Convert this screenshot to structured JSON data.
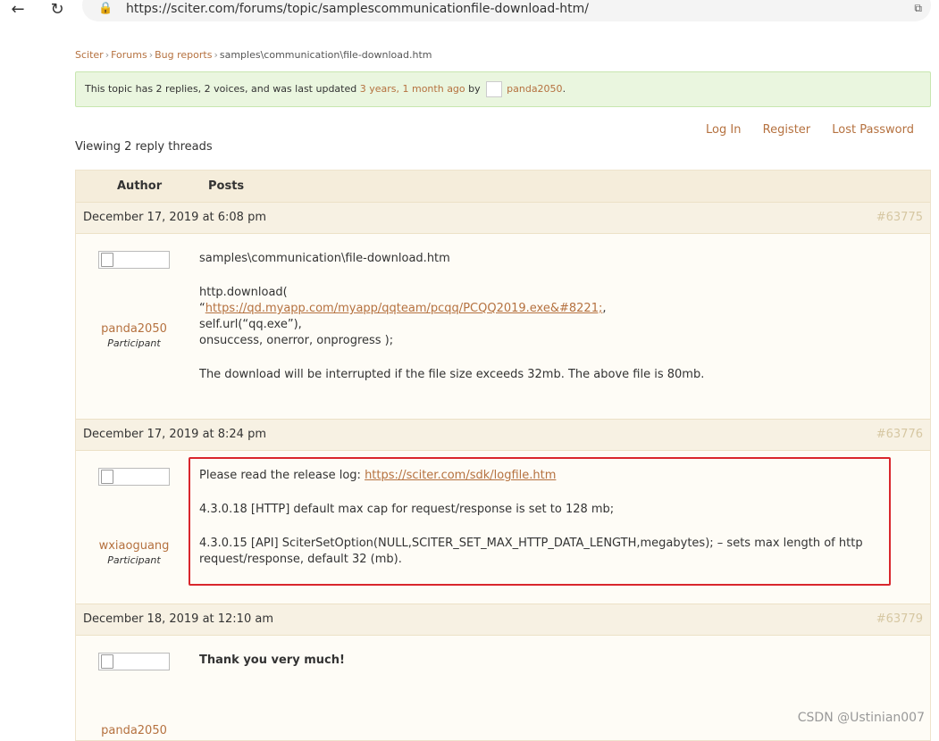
{
  "browser": {
    "url": "https://sciter.com/forums/topic/samplescommunicationfile-download-htm/",
    "back_icon": "←",
    "reload_icon": "↻",
    "lock_icon": "🔒",
    "tab_icon": "⧉"
  },
  "breadcrumb": {
    "items": [
      "Sciter",
      "Forums",
      "Bug reports"
    ],
    "current": "samples\\communication\\file-download.htm",
    "separator": "›"
  },
  "topic_info": {
    "prefix": "This topic has 2 replies, 2 voices, and was last updated ",
    "last_updated": "3 years, 1 month ago",
    "by": " by ",
    "user": "panda2050",
    "suffix": "."
  },
  "auth": {
    "login": "Log In",
    "register": "Register",
    "lost_password": "Lost Password"
  },
  "viewing": "Viewing 2 reply threads",
  "table": {
    "col_author": "Author",
    "col_posts": "Posts"
  },
  "posts": [
    {
      "date": "December 17, 2019 at 6:08 pm",
      "permalink": "#63775",
      "author": "panda2050",
      "role": "Participant",
      "lines": [
        "samples\\communication\\file-download.htm",
        "http.download(",
        "“",
        "https://qd.myapp.com/myapp/qqteam/pcqq/PCQQ2019.exe&#8221;",
        ",",
        "self.url(“qq.exe”),",
        "onsuccess, onerror, onprogress );",
        "The download will be interrupted if the file size exceeds 32mb. The above file is 80mb."
      ]
    },
    {
      "date": "December 17, 2019 at 8:24 pm",
      "permalink": "#63776",
      "author": "wxiaoguang",
      "role": "Participant",
      "lines": [
        "Please read the release log: ",
        "https://sciter.com/sdk/logfile.htm",
        "4.3.0.18 [HTTP] default max cap for request/response is set to 128 mb;",
        "4.3.0.15 [API] SciterSetOption(NULL,SCITER_SET_MAX_HTTP_DATA_LENGTH,megabytes); – sets max length of http request/response, default 32 (mb)."
      ]
    },
    {
      "date": "December 18, 2019 at 12:10 am",
      "permalink": "#63779",
      "author": "panda2050",
      "lines": [
        "Thank you very much!"
      ]
    }
  ],
  "watermark": "CSDN @Ustinian007"
}
